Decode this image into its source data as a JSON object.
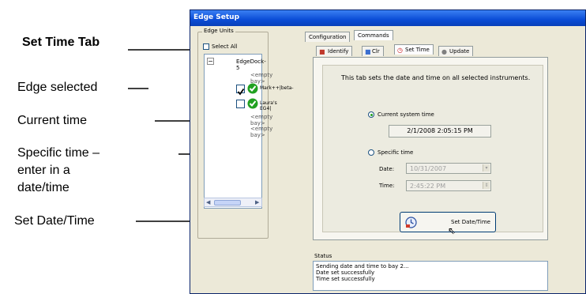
{
  "annotations": {
    "set_time_tab": "Set Time Tab",
    "edge_selected": "Edge selected",
    "current_time": "Current time",
    "specific_time_1": "Specific time –",
    "specific_time_2": "enter in a",
    "specific_time_3": "date/time",
    "set_date_time": "Set Date/Time"
  },
  "window": {
    "title": "Edge Setup"
  },
  "edge_units": {
    "group_label": "Edge Units",
    "select_all": "Select All",
    "dock": "EdgeDock-5",
    "items": [
      {
        "label": "<empty bay>"
      },
      {
        "label": "Mark++|beta-",
        "checked": true
      },
      {
        "label": "Laura's EG4|",
        "checked": false
      },
      {
        "label": "<empty bay>"
      },
      {
        "label": "<empty bay>"
      }
    ]
  },
  "outer_tabs": [
    "Configuration",
    "Commands"
  ],
  "inner_tabs": [
    "Identify",
    "Clr",
    "Set Time",
    "Update"
  ],
  "set_time": {
    "description": "This tab sets the date and time on all selected instruments.",
    "current_label": "Current system time",
    "current_value": "2/1/2008 2:05:15 PM",
    "specific_label": "Specific time",
    "date_label": "Date:",
    "date_value": "10/31/2007",
    "time_label": "Time:",
    "time_value": "2:45:22 PM",
    "button_label": "Set Date/Time"
  },
  "status": {
    "label": "Status",
    "lines": [
      "Sending date and time to bay 2...",
      "Date set successfully",
      "Time set successfully"
    ]
  },
  "colors": {
    "accent": "#0a4cd6",
    "check_green": "#21a121"
  }
}
